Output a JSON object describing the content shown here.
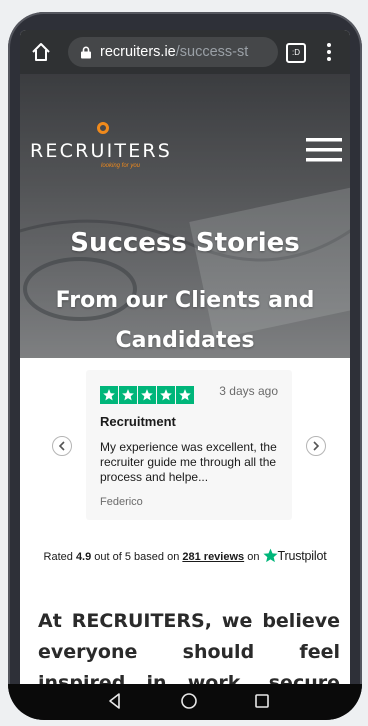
{
  "browser": {
    "url_host": "recruiters.ie",
    "url_path": "/success-st",
    "tab_count_label": ":D"
  },
  "header": {
    "logo_text": "RECRUITERS",
    "tagline": "looking for you"
  },
  "hero": {
    "title": "Success Stories",
    "subtitle": "From our Clients and Candidates"
  },
  "review": {
    "stars": 5,
    "time_ago": "3 days ago",
    "title": "Recruitment",
    "body": "My experience was excellent, the recruiter guide me through all the process and helpe...",
    "author": "Federico"
  },
  "trustpilot": {
    "rated_prefix": "Rated",
    "score": "4.9",
    "out_of": "out of 5 based on",
    "reviews_link": "281 reviews",
    "on": "on",
    "brand": "Trustpilot"
  },
  "intro_text": "At RECRUITERS, we believe everyone should feel inspired in work, secure when they're",
  "colors": {
    "accent_orange": "#f08a1c",
    "trustpilot_green": "#00b67a",
    "address_bar": "#2f3133"
  }
}
